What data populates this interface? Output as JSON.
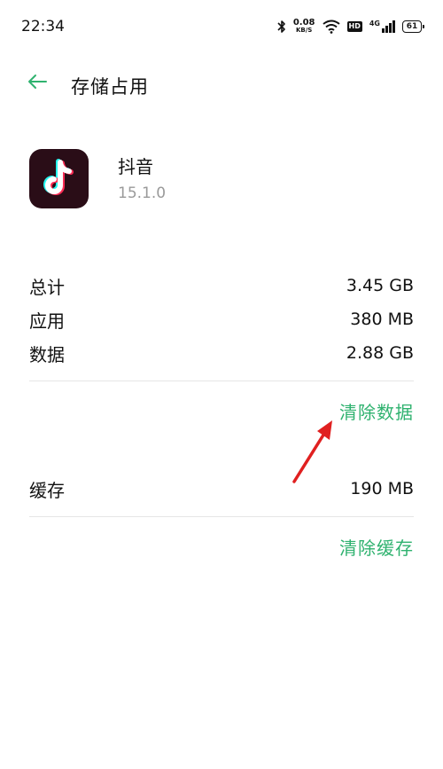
{
  "status_bar": {
    "time": "22:34",
    "net_speed_value": "0.08",
    "net_speed_unit": "KB/S",
    "hd_label": "HD",
    "network_label": "4G",
    "battery_level": "61"
  },
  "header": {
    "title": "存储占用"
  },
  "app": {
    "name": "抖音",
    "version": "15.1.0"
  },
  "storage": {
    "rows": [
      {
        "label": "总计",
        "value": "3.45 GB"
      },
      {
        "label": "应用",
        "value": "380 MB"
      },
      {
        "label": "数据",
        "value": "2.88 GB"
      }
    ],
    "clear_data_label": "清除数据",
    "cache": {
      "label": "缓存",
      "value": "190 MB"
    },
    "clear_cache_label": "清除缓存"
  },
  "colors": {
    "accent": "#2fb26f",
    "annotation_arrow": "#e02020"
  },
  "icons": {
    "back": "arrow-left-icon",
    "app": "tiktok-logo-icon"
  }
}
